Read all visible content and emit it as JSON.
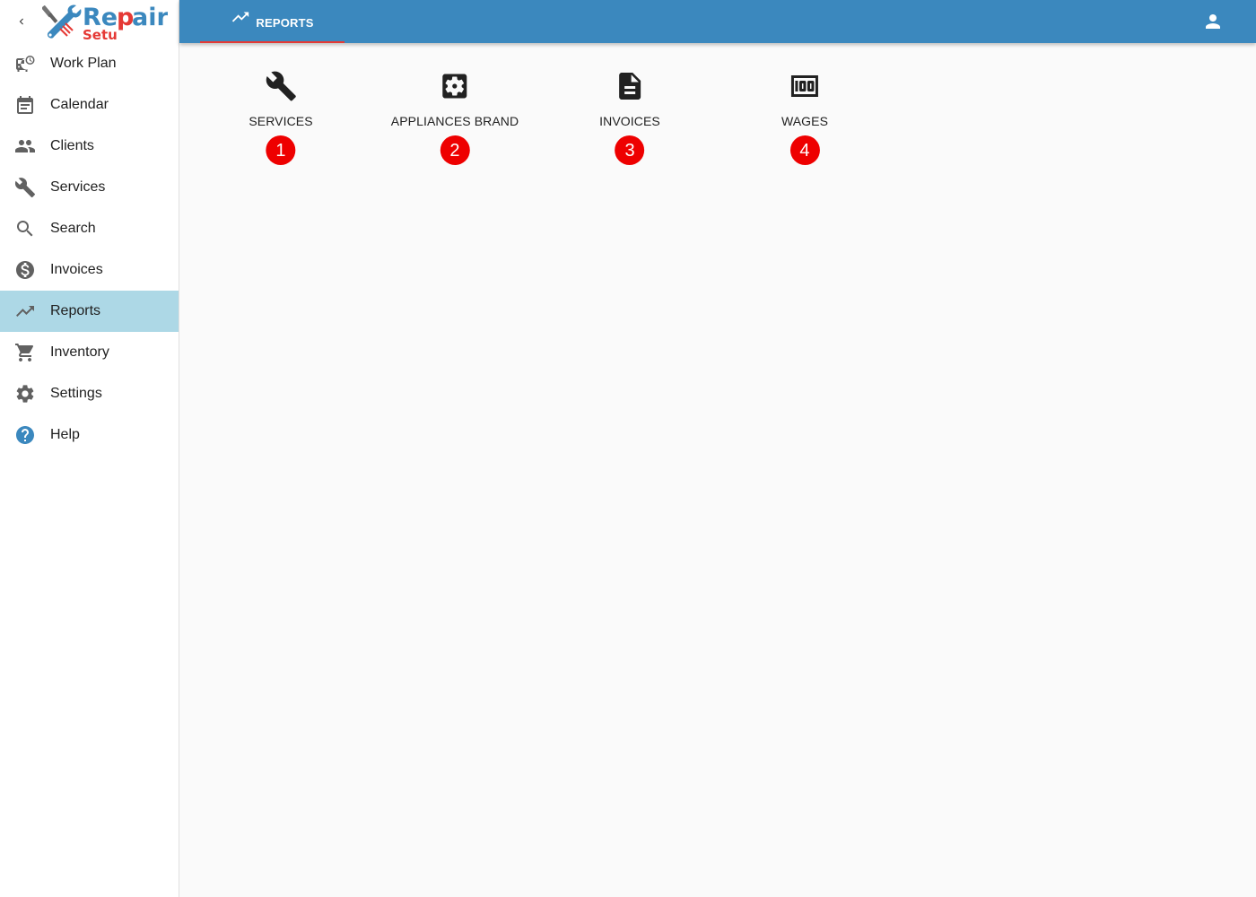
{
  "app": {
    "logo_text_primary": "Repair",
    "logo_text_secondary": "Setup"
  },
  "sidebar": {
    "items": [
      {
        "label": "Work Plan",
        "icon": "work-plan-icon",
        "active": false
      },
      {
        "label": "Calendar",
        "icon": "calendar-icon",
        "active": false
      },
      {
        "label": "Clients",
        "icon": "clients-icon",
        "active": false
      },
      {
        "label": "Services",
        "icon": "wrench-icon",
        "active": false
      },
      {
        "label": "Search",
        "icon": "search-icon",
        "active": false
      },
      {
        "label": "Invoices",
        "icon": "dollar-icon",
        "active": false
      },
      {
        "label": "Reports",
        "icon": "trending-up-icon",
        "active": true
      },
      {
        "label": "Inventory",
        "icon": "cart-icon",
        "active": false
      },
      {
        "label": "Settings",
        "icon": "gear-icon",
        "active": false
      },
      {
        "label": "Help",
        "icon": "help-icon",
        "active": false
      }
    ]
  },
  "topbar": {
    "tab_label": "REPORTS",
    "tab_icon": "trending-up-icon",
    "account_icon": "account-icon"
  },
  "reports": [
    {
      "label": "SERVICES",
      "icon": "wrench-icon",
      "badge": "1"
    },
    {
      "label": "APPLIANCES BRAND",
      "icon": "settings-box-icon",
      "badge": "2"
    },
    {
      "label": "INVOICES",
      "icon": "document-icon",
      "badge": "3"
    },
    {
      "label": "WAGES",
      "icon": "money-icon",
      "badge": "4"
    }
  ],
  "colors": {
    "topbar": "#3b88be",
    "active_nav": "#add8e6",
    "tab_indicator": "#e53935",
    "badge": "#ee0000",
    "logo_blue": "#3b88be",
    "logo_red": "#e53935"
  }
}
